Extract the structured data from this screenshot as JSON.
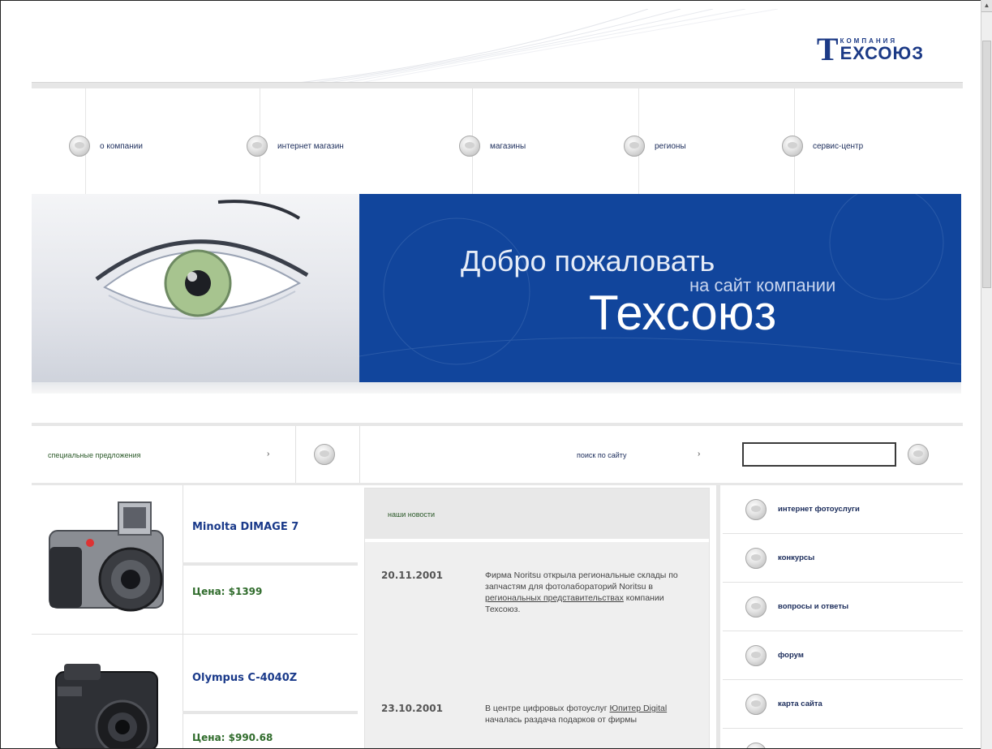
{
  "logo": {
    "mark": "T",
    "small": "КОМПАНИЯ",
    "big": "ЕХСОЮЗ"
  },
  "nav": {
    "items": [
      {
        "label": "о компании"
      },
      {
        "label": "интернет магазин"
      },
      {
        "label": "магазины"
      },
      {
        "label": "регионы"
      },
      {
        "label": "сервис-центр"
      }
    ]
  },
  "hero": {
    "line1": "Добро пожаловать",
    "line2": "на сайт компании",
    "line3": "Техсоюз"
  },
  "toolbar": {
    "special_label": "специальные предложения",
    "special_arrow": "›",
    "search_label": "поиск по сайту",
    "search_arrow": "›",
    "search_value": ""
  },
  "products": [
    {
      "name": "Minolta DIMAGE 7",
      "price": "Цена: $1399"
    },
    {
      "name": "Olympus C-4040Z",
      "price": "Цена: $990.68"
    }
  ],
  "news": {
    "title": "наши новости",
    "items": [
      {
        "date": "20.11.2001",
        "text_before": "Фирма Noritsu открыла региональные склады по запчастям для фотолабораторий Noritsu в ",
        "link": "региональных представительствах",
        "text_after": " компании Техсоюз."
      },
      {
        "date": "23.10.2001",
        "text_before": "В центре цифровых фотоуслуг ",
        "link": "Юпитер Digital",
        "text_after": " началась раздача подарков от фирмы"
      }
    ]
  },
  "sidebar": {
    "items": [
      {
        "label": "интернет фотоуслуги"
      },
      {
        "label": "конкурсы"
      },
      {
        "label": "вопросы и ответы"
      },
      {
        "label": "форум"
      },
      {
        "label": "карта сайта"
      }
    ]
  },
  "colors": {
    "brand_blue": "#11459c",
    "link_blue": "#1a3a8a",
    "price_green": "#2f6b2b"
  }
}
